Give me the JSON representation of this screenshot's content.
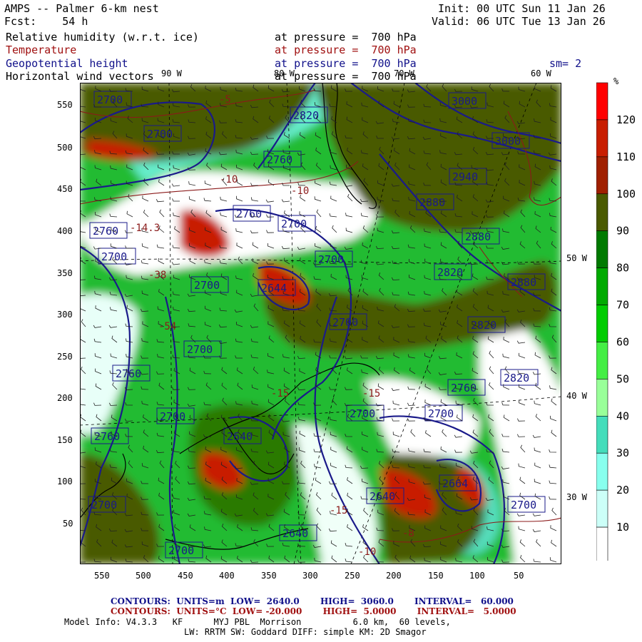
{
  "header": {
    "title": "AMPS -- Palmer 6-km nest",
    "fcst": "Fcst:    54 h",
    "init": "Init: 00 UTC Sun 11 Jan 26",
    "valid": "Valid: 06 UTC Tue 13 Jan 26",
    "fields": [
      {
        "name": "Relative humidity (w.r.t. ice)",
        "level": "at pressure =  700 hPa",
        "color": "#000000"
      },
      {
        "name": "Temperature",
        "level": "at pressure =  700 hPa",
        "color": "#a01010"
      },
      {
        "name": "Geopotential height",
        "level": "at pressure =  700 hPa",
        "color": "#10108a"
      },
      {
        "name": "Horizontal wind vectors",
        "level": "at pressure =  700 hPa",
        "color": "#000000"
      }
    ],
    "smoothing": "sm= 2"
  },
  "axes": {
    "y_ticks": [
      "550",
      "500",
      "450",
      "400",
      "350",
      "300",
      "250",
      "200",
      "150",
      "100",
      "50"
    ],
    "x_ticks": [
      "550",
      "500",
      "450",
      "400",
      "350",
      "300",
      "250",
      "200",
      "150",
      "100",
      "50"
    ],
    "lon_labels": [
      "90 W",
      "80 W",
      "70 W",
      "60 W",
      "50 W",
      "40 W",
      "30 W"
    ]
  },
  "legend": {
    "unit": "%",
    "labels": [
      "120",
      "110",
      "100",
      "90",
      "80",
      "70",
      "60",
      "50",
      "40",
      "30",
      "20",
      "10"
    ],
    "colors": [
      "#ff0000",
      "#c81e00",
      "#a02000",
      "#4a5a00",
      "#007a00",
      "#00aa00",
      "#00cc00",
      "#44ee44",
      "#99ff99",
      "#44ddbb",
      "#88ffee",
      "#ccfff8",
      "#ffffff"
    ]
  },
  "contour_labels": {
    "height": [
      "2700",
      "2700",
      "2760",
      "2820",
      "3000",
      "3000",
      "2760",
      "2940",
      "2880",
      "2880",
      "2760",
      "2700",
      "2700",
      "2700",
      "2644",
      "2700",
      "2880",
      "2820",
      "2700",
      "2820",
      "2700",
      "2760",
      "2820",
      "2760",
      "2700",
      "2700",
      "2700",
      "2760",
      "2640",
      "2700",
      "2640",
      "2664",
      "2700",
      "2640",
      "2700"
    ],
    "temp": [
      "-5",
      "-10",
      "-10",
      "-14.3",
      "-38",
      "-54",
      "-15",
      "-15",
      "-15",
      "-8",
      "-10"
    ]
  },
  "footer": {
    "line1_height": "CONTOURS:  UNITS=m  LOW=  2640.0       HIGH=  3060.0       INTERVAL=   60.000",
    "line2_temp": "CONTOURS:  UNITS=°C  LOW= -20.000       HIGH=  5.0000       INTERVAL=   5.0000",
    "line3": "Model Info: V4.3.3   KF      MYJ PBL  Morrison          6.0 km,  60 levels,",
    "line4": "LW: RRTM SW: Goddard DIFF: simple KM: 2D Smagor"
  }
}
